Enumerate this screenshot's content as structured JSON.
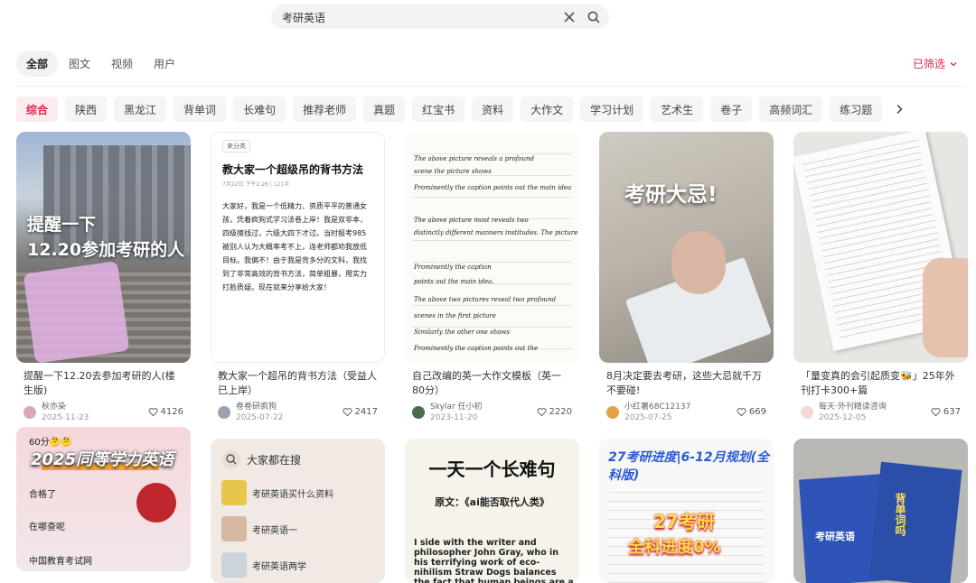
{
  "search": {
    "query": "考研英语"
  },
  "tabs": [
    "全部",
    "图文",
    "视频",
    "用户"
  ],
  "filter_label": "已筛选",
  "chips": [
    "综合",
    "陕西",
    "黑龙江",
    "背单词",
    "长难句",
    "推荐老师",
    "真题",
    "红宝书",
    "资料",
    "大作文",
    "学习计划",
    "艺术生",
    "卷子",
    "高频词汇",
    "练习题"
  ],
  "colors": {
    "accent": "#e0244a"
  },
  "cards": [
    {
      "title": "提醒一下12.20去参加考研的人(楼生版)",
      "user": "秋亦染",
      "date": "2025-11-23",
      "likes": "4126",
      "cover_text": [
        "提醒一下",
        "12.20参加考研的人"
      ]
    },
    {
      "title": "教大家一个超吊的背书方法（受益人已上岸）",
      "user": "卷卷研疯狗",
      "date": "2025-07-22",
      "likes": "2417",
      "cover_tag": "来分类",
      "cover_heading": "教大家一个超级吊的背书方法",
      "cover_sub": "7月22日  下午2:26  |  121字",
      "cover_body": "大家好，我是一个低精力、资质平平的普通女孩，凭着疯狗式学习法卷上岸！我是双非本，四级擦线过，六级大四下才过。当时报考985被别人认为大概率考不上，连老师都劝我放低目标。我偏不！由于我是背多分的文科，我找到了非常高效的背书方法，简单粗暴，用实力打脸质疑。现在就来分享给大家！"
    },
    {
      "title": "自己改编的英一大作文模板（英一80分）",
      "user": "Skylar 任小初",
      "date": "2023-11-20",
      "likes": "2220",
      "cover_lines": [
        "The above picture reveals a profound",
        "scene  the picture shows",
        "Prominently the caption points out the main idea",
        "The above picture most reveals two",
        "distinctly different manners institudes. The picture",
        "Prominently the caption",
        "points out the main idea.",
        "The above two pictures reveal two profound",
        "scenes in the first picture",
        "Similarly the other one shows",
        "Prominently the caption points out the"
      ]
    },
    {
      "title": "8月决定要去考研，这些大忌就千万不要碰!",
      "user": "小红薯68C12137",
      "date": "2025-07-25",
      "likes": "669",
      "cover_text": [
        "考研大忌!"
      ]
    },
    {
      "title": "「量变真的会引起质变🐝」25年外刊打卡300+篇",
      "user": "每天·外刊精读咨询",
      "date": "2025-12-05",
      "likes": "637"
    },
    {
      "cover_top": "60分🤔🤔",
      "cover_big": "2025同等学力英语",
      "cover_side": [
        "合格了",
        "在哪查呢",
        "中国教育考试网"
      ]
    },
    {
      "cover_head": "大家都在搜",
      "cover_rows": [
        "考研英语买什么资料",
        "考研英语一",
        "考研英语两学"
      ]
    },
    {
      "cover_heading": "一天一个长难句",
      "cover_sub": "原文：《ai能否取代人类》",
      "cover_para": "I side with the writer and philosopher John Gray, who in his terrifying work of eco-nihilism Straw Dogs balances the fact that human beings are a plague"
    },
    {
      "cover_heading": "27考研进度|6-12月规划(全科版)",
      "cover_big": [
        "27考研",
        "全科进度0%"
      ]
    },
    {
      "cover_book": [
        "考研英语",
        "背单词吗"
      ]
    }
  ]
}
